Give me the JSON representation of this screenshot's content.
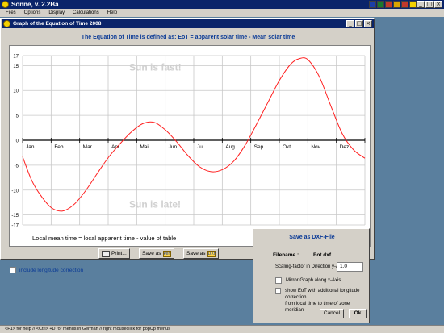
{
  "app": {
    "title": "Sonne,  v. 2.2Ba",
    "window_controls": [
      "_",
      "□",
      "×"
    ]
  },
  "tray_icons": [
    {
      "name": "word-icon",
      "color": "#1b3fa8"
    },
    {
      "name": "excel-icon",
      "color": "#1a7a2e"
    },
    {
      "name": "mail-icon",
      "color": "#c0392b"
    },
    {
      "name": "app-icon",
      "color": "#d9a400"
    },
    {
      "name": "calc-icon",
      "color": "#c0392b"
    },
    {
      "name": "sun-icon",
      "color": "#f4d000"
    }
  ],
  "menu": [
    "Files",
    "Options",
    "Display",
    "Calculations",
    "Help"
  ],
  "graph_window": {
    "title": "Graph of the Equation of Time  2008",
    "controls": [
      "_",
      "□",
      "×"
    ],
    "heading": "The Equation of Time is defined as:  EoT = apparent solar time - Mean solar time"
  },
  "chart_data": {
    "type": "line",
    "x_categories": [
      "Jan",
      "Feb",
      "Mar",
      "Apr",
      "Mai",
      "Jun",
      "Jul",
      "Aug",
      "Sep",
      "Okt",
      "Nov",
      "Dez"
    ],
    "y_ticks": [
      17,
      15,
      10,
      5,
      0,
      -5,
      -10,
      -15,
      -17
    ],
    "ylim": [
      -17,
      17
    ],
    "x_units": "month",
    "series": [
      {
        "color": "#ff2020",
        "x": [
          0.0,
          0.3,
          0.6,
          1.0,
          1.4,
          1.8,
          2.2,
          2.6,
          3.0,
          3.4,
          3.8,
          4.2,
          4.6,
          5.0,
          5.4,
          5.8,
          6.2,
          6.6,
          7.0,
          7.4,
          7.8,
          8.2,
          8.6,
          9.0,
          9.4,
          9.7,
          10.0,
          10.4,
          10.8,
          11.2,
          11.6,
          12.0
        ],
        "y": [
          -3.3,
          -7.8,
          -10.8,
          -13.5,
          -14.2,
          -12.9,
          -10.2,
          -6.8,
          -3.5,
          -0.8,
          1.6,
          3.3,
          3.6,
          2.1,
          -0.3,
          -3.1,
          -5.3,
          -6.3,
          -5.9,
          -4.2,
          -1.0,
          3.2,
          7.6,
          12.0,
          15.3,
          16.4,
          16.2,
          12.8,
          7.0,
          1.4,
          -1.9,
          -3.6
        ]
      }
    ],
    "annotations": {
      "upper": "Sun is fast!",
      "lower": "Sun is late!",
      "footer": "Local mean time = local apparent time - value of table"
    },
    "grid": true
  },
  "controls": {
    "longitude_label": "include longitude correction",
    "print_label": "Print...",
    "save_as_label": "Save as",
    "save_as_icon_1": "Per",
    "save_as_icon_2": "DXF"
  },
  "dxf_dialog": {
    "title": "Save as DXF-File",
    "filename_label": "Filename :",
    "filename": "Eot.dxf",
    "scale_label": "Scaling-factor in Direction y-Axis",
    "scale_value": "1.0",
    "mirror_label": "Mirror Graph along x-Axis",
    "show_label_1": "show EoT with additional longitude correction",
    "show_label_2": "from local time to time of zone meridian",
    "cancel_label": "Cancel",
    "ok_label": "Ok"
  },
  "statusbar": "<F1> for help  //  <Ctrl> +D  for menus in German  //  right mouseclick for popUp menus"
}
